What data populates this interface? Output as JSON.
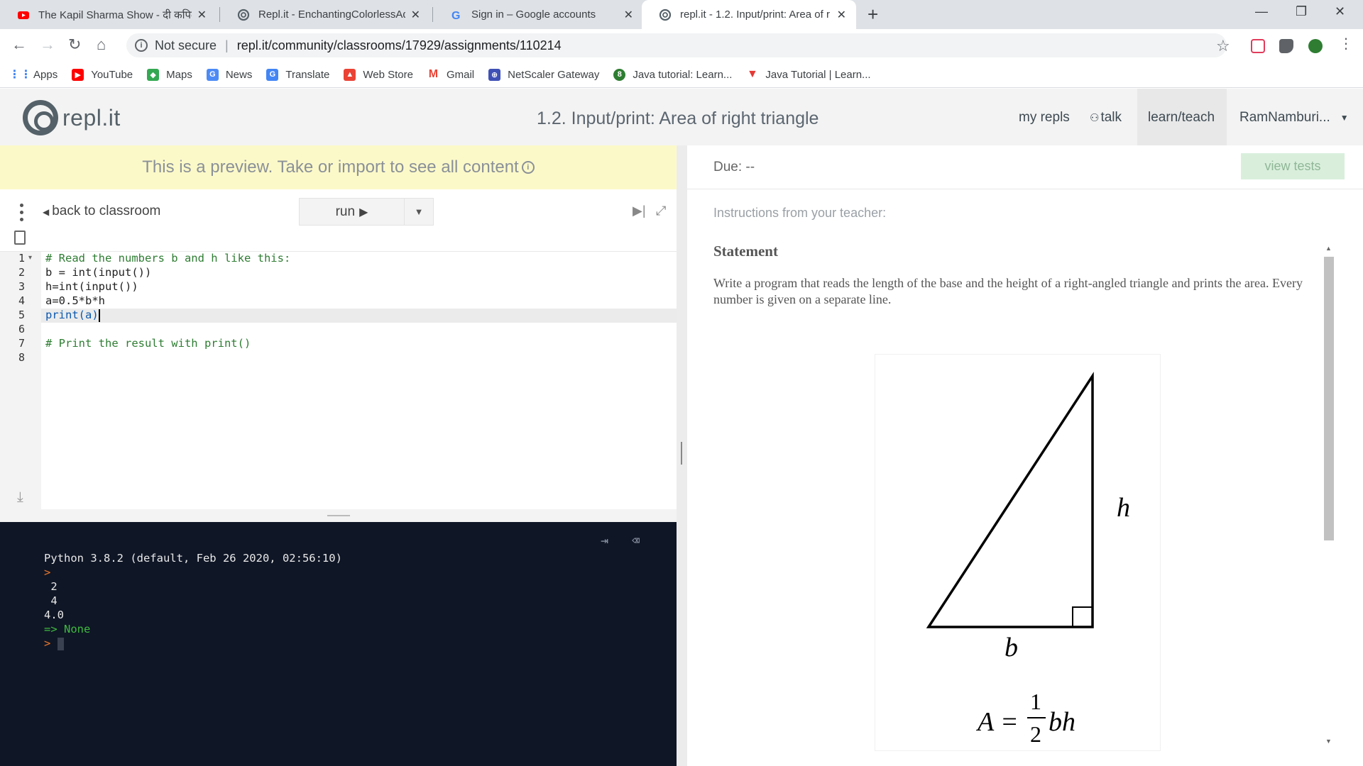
{
  "browser": {
    "tabs": [
      {
        "title": "The Kapil Sharma Show - दी कपिल",
        "icon": "youtube-icon",
        "color": "#ff0000"
      },
      {
        "title": "Repl.it - EnchantingColorlessAdm",
        "icon": "replit-icon",
        "color": "#556168"
      },
      {
        "title": "Sign in – Google accounts",
        "icon": "google-icon",
        "color": "#4285f4"
      },
      {
        "title": "repl.it - 1.2. Input/print: Area of r",
        "icon": "replit-icon",
        "color": "#556168"
      }
    ],
    "security_label": "Not secure",
    "url": "repl.it/community/classrooms/17929/assignments/110214",
    "bookmarks": [
      {
        "label": "Apps",
        "icon": "apps-grid-icon"
      },
      {
        "label": "YouTube",
        "icon": "youtube-icon"
      },
      {
        "label": "Maps",
        "icon": "maps-icon"
      },
      {
        "label": "News",
        "icon": "news-icon"
      },
      {
        "label": "Translate",
        "icon": "translate-icon"
      },
      {
        "label": "Web Store",
        "icon": "webstore-icon"
      },
      {
        "label": "Gmail",
        "icon": "gmail-icon"
      },
      {
        "label": "NetScaler Gateway",
        "icon": "netscaler-icon"
      },
      {
        "label": "Java tutorial: Learn...",
        "icon": "java-tutorial-icon"
      },
      {
        "label": "Java Tutorial | Learn...",
        "icon": "javatpoint-icon"
      }
    ]
  },
  "header": {
    "logo_text": "repl.it",
    "page_title": "1.2. Input/print: Area of right triangle",
    "nav": {
      "my_repls": "my repls",
      "talk": "talk",
      "learn_teach": "learn/teach",
      "user": "RamNamburi..."
    }
  },
  "editor": {
    "preview_banner": "This is a preview. Take or import to see all content",
    "back_label": "back to classroom",
    "run_label": "run",
    "line_numbers": [
      "1",
      "2",
      "3",
      "4",
      "5",
      "6",
      "7",
      "8"
    ],
    "lines": [
      "# Read the numbers b and h like this:",
      "b = int(input())",
      "h=int(input())",
      "a=0.5*b*h",
      "print(a)",
      "",
      "# Print the result with print()",
      ""
    ]
  },
  "console": {
    "banner": "Python 3.8.2 (default, Feb 26 2020, 02:56:10)",
    "prompt": ">",
    "inputs": [
      " 2",
      " 4"
    ],
    "output": "4.0",
    "return_value": "=> None"
  },
  "assignment": {
    "due": "Due: --",
    "view_tests": "view tests",
    "instructions_label": "Instructions from your teacher:",
    "statement_heading": "Statement",
    "statement_text": "Write a program that reads the length of the base and the height of a right-angled triangle and prints the area. Every number is given on a separate line.",
    "figure": {
      "height_label": "h",
      "base_label": "b",
      "formula_lhs": "A =",
      "formula_num": "1",
      "formula_den": "2",
      "formula_rhs": "bh"
    }
  },
  "colors": {
    "preview_bg": "#fcf9c9",
    "console_bg": "#0f1626",
    "view_tests_bg": "#d9efdc",
    "comment": "#2e7d32"
  }
}
